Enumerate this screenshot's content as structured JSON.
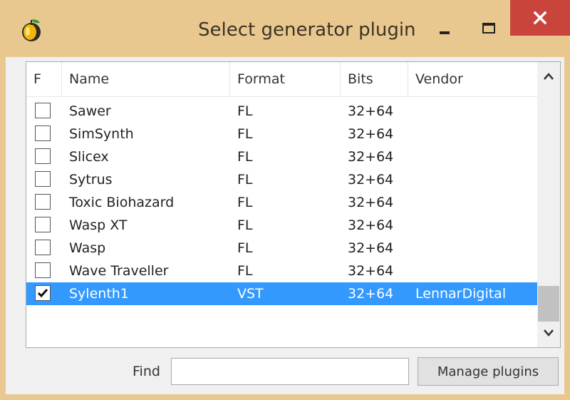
{
  "window": {
    "title": "Select generator plugin",
    "accent_color": "#e9c88f",
    "close_color": "#c9443a"
  },
  "table": {
    "columns": [
      "F",
      "Name",
      "Format",
      "Bits",
      "Vendor"
    ],
    "rows": [
      {
        "checked": false,
        "name": "Sawer",
        "format": "FL",
        "bits": "32+64",
        "vendor": ""
      },
      {
        "checked": false,
        "name": "SimSynth",
        "format": "FL",
        "bits": "32+64",
        "vendor": ""
      },
      {
        "checked": false,
        "name": "Slicex",
        "format": "FL",
        "bits": "32+64",
        "vendor": ""
      },
      {
        "checked": false,
        "name": "Sytrus",
        "format": "FL",
        "bits": "32+64",
        "vendor": ""
      },
      {
        "checked": false,
        "name": "Toxic Biohazard",
        "format": "FL",
        "bits": "32+64",
        "vendor": ""
      },
      {
        "checked": false,
        "name": "Wasp XT",
        "format": "FL",
        "bits": "32+64",
        "vendor": ""
      },
      {
        "checked": false,
        "name": "Wasp",
        "format": "FL",
        "bits": "32+64",
        "vendor": ""
      },
      {
        "checked": false,
        "name": "Wave Traveller",
        "format": "FL",
        "bits": "32+64",
        "vendor": ""
      },
      {
        "checked": true,
        "name": "Sylenth1",
        "format": "VST",
        "bits": "32+64",
        "vendor": "LennarDigital",
        "selected": true
      }
    ],
    "selected_color": "#3399ff"
  },
  "footer": {
    "find_label": "Find",
    "find_value": "",
    "manage_label": "Manage plugins"
  },
  "icons": {
    "app": "fl-studio-fruit-icon",
    "minimize": "minimize-icon",
    "maximize": "maximize-icon",
    "close": "close-icon",
    "scroll_up": "chevron-up-icon",
    "scroll_down": "chevron-down-icon",
    "check": "checkmark-icon"
  }
}
